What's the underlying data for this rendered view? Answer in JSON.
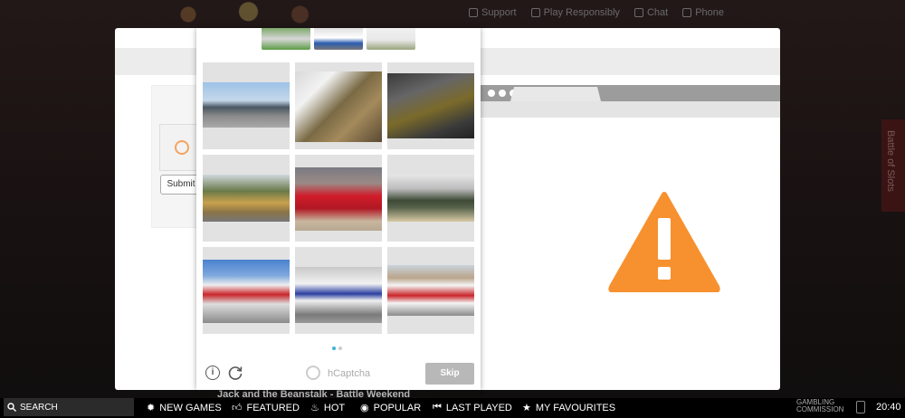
{
  "top_nav": [
    "Support",
    "Play Responsibly",
    "Chat",
    "Phone"
  ],
  "side_tab": "Battle of Slots",
  "form": {
    "submit_label": "Submit"
  },
  "hcaptcha": {
    "brand": "hCaptcha",
    "skip_label": "Skip",
    "info_icon": "i",
    "pager": {
      "pages": 2,
      "active": 1
    },
    "tiles": [
      {
        "name": "tile-airplane"
      },
      {
        "name": "tile-street"
      },
      {
        "name": "tile-motorbike"
      },
      {
        "name": "tile-bus-yellow"
      },
      {
        "name": "tile-red-car"
      },
      {
        "name": "tile-military-truck"
      },
      {
        "name": "tile-bus-red"
      },
      {
        "name": "tile-bus-white"
      },
      {
        "name": "tile-bus-red-white"
      }
    ]
  },
  "background": {
    "caption": "Jack and the Beanstalk - Battle Weekend"
  },
  "taskbar": {
    "search_label": "SEARCH",
    "items": [
      "NEW GAMES",
      "FEATURED",
      "HOT",
      "POPULAR",
      "LAST PLAYED",
      "MY FAVOURITES"
    ],
    "commission_line1": "GAMBLING",
    "commission_line2": "COMMISSION",
    "time": "20:40"
  },
  "colors": {
    "warning": "#f7912f",
    "pager_active": "#3db4d6",
    "skip_bg": "#b8b8b8"
  }
}
